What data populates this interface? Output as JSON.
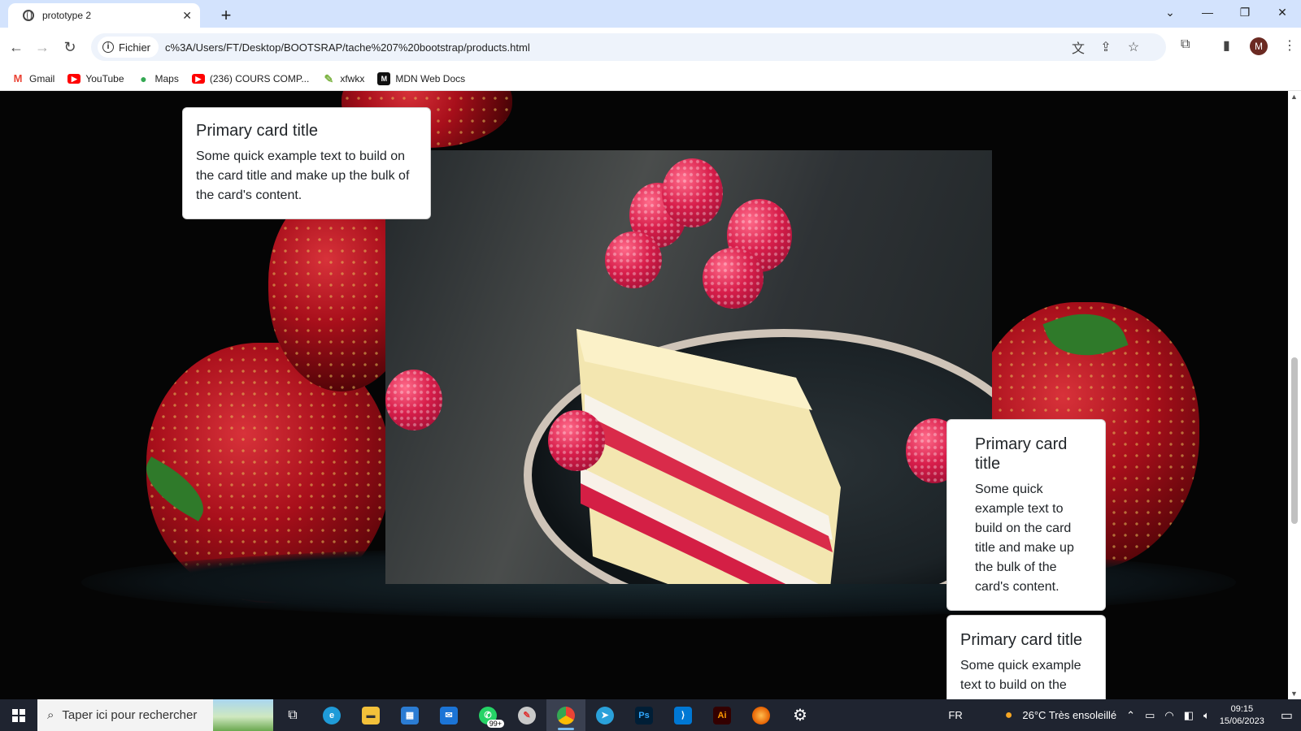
{
  "browser": {
    "tab_title": "prototype 2",
    "omnibox_chip": "Fichier",
    "url": "c%3A/Users/FT/Desktop/BOOTSRAP/tache%207%20bootstrap/products.html",
    "profile_initial": "M",
    "bookmarks": [
      {
        "label": "Gmail",
        "icon": "gmail-icon",
        "color": "#ea4335"
      },
      {
        "label": "YouTube",
        "icon": "youtube-icon",
        "color": "#ff0000"
      },
      {
        "label": "Maps",
        "icon": "maps-icon",
        "color": "#34a853"
      },
      {
        "label": "(236) COURS COMP...",
        "icon": "youtube-icon",
        "color": "#ff0000"
      },
      {
        "label": "xfwkx",
        "icon": "xfwkx-icon",
        "color": "#7cb342"
      },
      {
        "label": "MDN Web Docs",
        "icon": "mdn-icon",
        "color": "#111111"
      }
    ]
  },
  "cards": [
    {
      "title": "Primary card title",
      "text": "Some quick example text to build on the card title and make up the bulk of the card's content."
    },
    {
      "title": "Primary card title",
      "text": "Some quick example text to build on the card title and make up the bulk of the card's content."
    },
    {
      "title": "Primary card title",
      "text": "Some quick example text to build on the"
    }
  ],
  "taskbar": {
    "search_placeholder": "Taper ici pour rechercher",
    "whatsapp_badge": "99+",
    "language": "FR",
    "weather": "26°C  Très ensoleillé",
    "time": "09:15",
    "date": "15/06/2023"
  }
}
